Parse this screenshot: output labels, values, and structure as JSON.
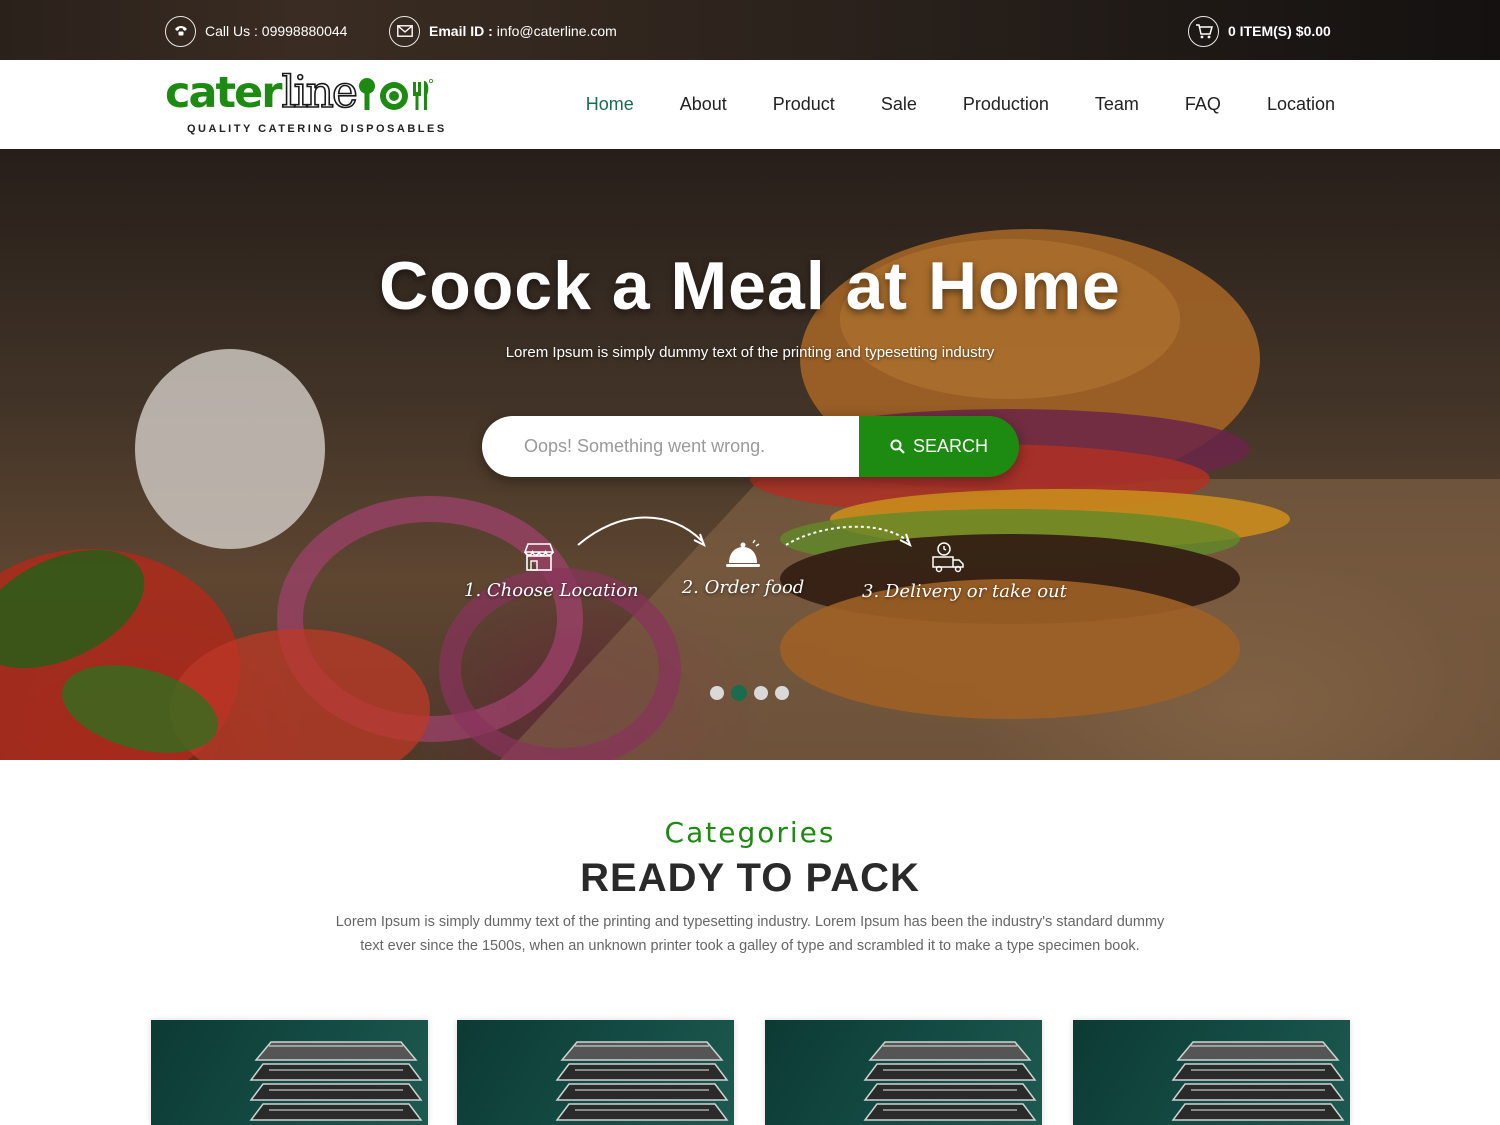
{
  "topbar": {
    "call_text": "Call Us : 09998880044",
    "email_label": "Email ID :",
    "email_value": "info@caterline.com",
    "cart_items": "0 ITEM(S)",
    "cart_total": "$0.00"
  },
  "brand": {
    "name_part1": "cater",
    "name_part2": "line",
    "tagline": "QUALITY CATERING DISPOSABLES",
    "color": "#1d8a12"
  },
  "nav": {
    "items": [
      "Home",
      "About",
      "Product",
      "Sale",
      "Production",
      "Team",
      "FAQ",
      "Location"
    ],
    "active": "Home"
  },
  "hero": {
    "title": "Coock a Meal at Home",
    "subtitle": "Lorem Ipsum is simply dummy text of the printing and typesetting industry",
    "search_placeholder": "Oops! Something went wrong.",
    "search_button": "SEARCH",
    "steps": [
      "1. Choose Location",
      "2. Order food",
      "3. Delivery or take out"
    ],
    "slides_total": 4,
    "slide_active": 2
  },
  "categories": {
    "eyebrow": "Categories",
    "title": "READY TO PACK",
    "description": "Lorem Ipsum is simply dummy text of the printing and typesetting industry. Lorem Ipsum has been the industry's standard dummy text ever since the 1500s, when an unknown printer took a galley of type and scrambled it to make a type specimen book.",
    "cards": 4
  },
  "colors": {
    "accent_green": "#1d8a12",
    "nav_active": "#1b6b4e",
    "dot_active": "#1b6b4e"
  }
}
